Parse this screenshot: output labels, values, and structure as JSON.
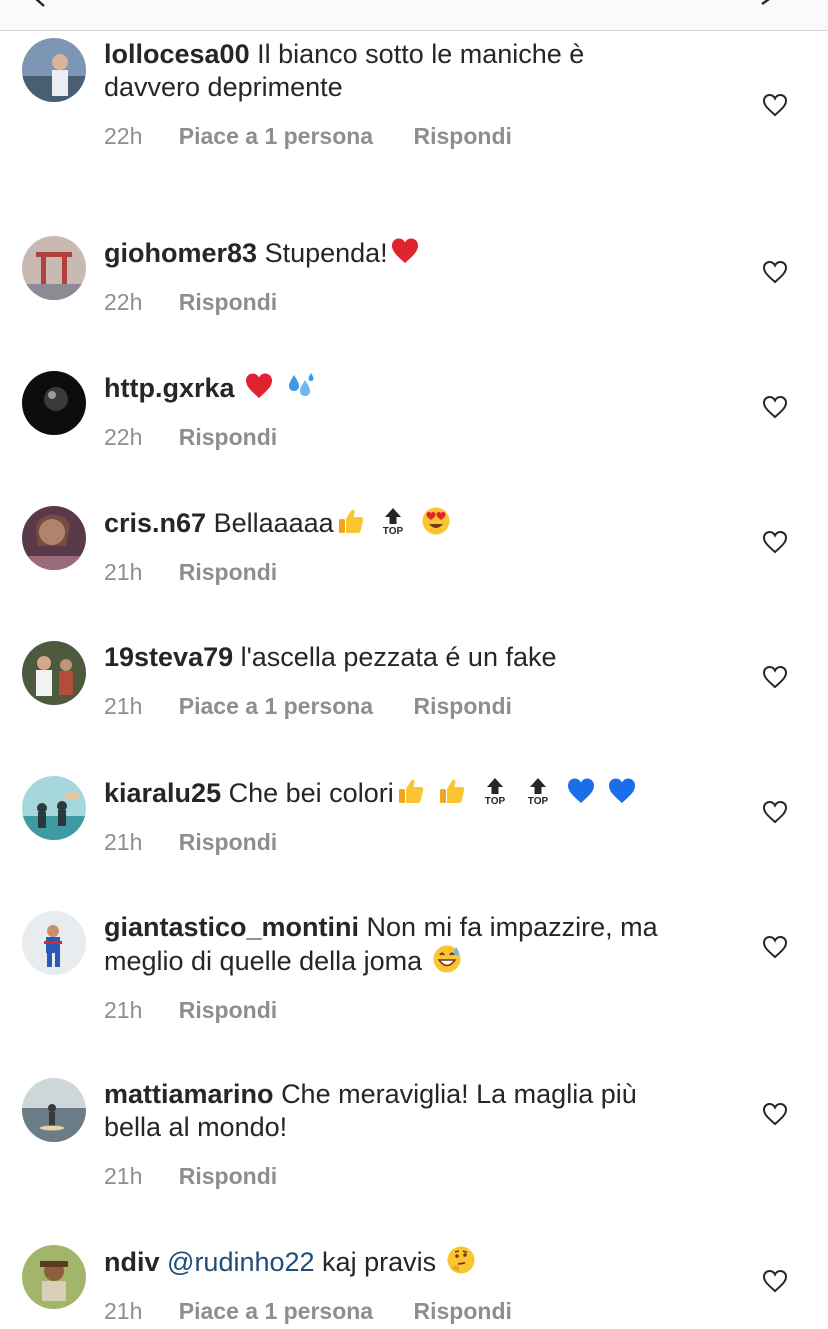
{
  "comments": [
    {
      "user": "lollocesa00",
      "text": "Il bianco sotto le maniche è",
      "text2": "davvero deprimente",
      "time": "22h",
      "likes": "Piace a 1 persona",
      "reply": "Rispondi"
    },
    {
      "user": "giohomer83",
      "text": "Stupenda!",
      "time": "22h",
      "reply": "Rispondi"
    },
    {
      "user": "http.gxrka",
      "text": "",
      "time": "22h",
      "reply": "Rispondi"
    },
    {
      "user": "cris.n67",
      "text": "Bellaaaaa",
      "time": "21h",
      "reply": "Rispondi"
    },
    {
      "user": "19steva79",
      "text": "l'ascella pezzata é un fake",
      "time": "21h",
      "likes": "Piace a 1 persona",
      "reply": "Rispondi"
    },
    {
      "user": "kiaralu25",
      "text": "Che bei colori",
      "time": "21h",
      "reply": "Rispondi"
    },
    {
      "user": "giantastico_montini",
      "text": "Non mi fa impazzire, ma",
      "text2": "meglio di quelle della joma",
      "time": "21h",
      "reply": "Rispondi"
    },
    {
      "user": "mattiamarino",
      "text": "Che meraviglia! La maglia più",
      "text2": "bella al mondo!",
      "time": "21h",
      "reply": "Rispondi"
    },
    {
      "user": "ndiv",
      "mention": "@rudinho22",
      "text": " kaj pravis",
      "time": "21h",
      "likes": "Piace a 1 persona",
      "reply": "Rispondi"
    }
  ],
  "emoji": {
    "top_label": "TOP"
  },
  "colors": {
    "text": "#262626",
    "meta": "#8e8e8e",
    "mention": "#1f4d7a",
    "heart_red": "#e0232e",
    "heart_blue": "#1a6ee8",
    "emoji_yellow": "#fbc531"
  }
}
